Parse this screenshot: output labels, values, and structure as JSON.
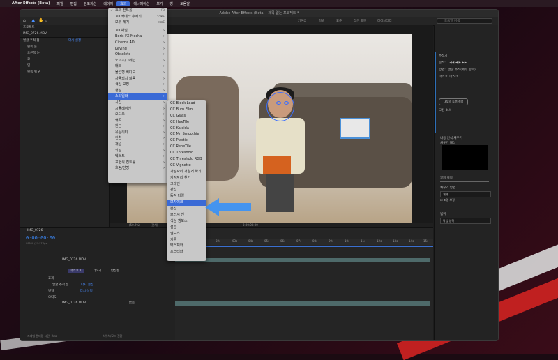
{
  "menubar": {
    "app_name": "After Effects (Beta)",
    "items": [
      "파일",
      "편집",
      "컴포지션",
      "레이어",
      "효과",
      "애니메이션",
      "보기",
      "창",
      "도움말"
    ],
    "active": "효과"
  },
  "window": {
    "title": "Adobe After Effects (Beta) - 제목 없는 프로젝트 *",
    "workspaces": [
      "기본값",
      "학습",
      "표준",
      "작은 화면",
      "라이브러리"
    ],
    "search_placeholder": "도움말 검색"
  },
  "project": {
    "tab": "프로젝트",
    "comp_tab": "IMG_0726",
    "comp_file": "IMG_0726.MOV",
    "items": [
      "얼굴 추적 점",
      "왼쪽 눈",
      "오른쪽 눈",
      "코",
      "입",
      "왼쪽 위 귀"
    ],
    "reset_label": "다시 설정"
  },
  "viewer": {
    "zoom": "(50.2%)",
    "quality": "(전체)",
    "timecode": "0:00:00:00"
  },
  "effects_menu": {
    "items": [
      {
        "label": "효과 컨트롤",
        "check": true,
        "shortcut": "F3"
      },
      {
        "label": "3D 카메라 추적기",
        "shortcut": "⌥⌘E"
      },
      {
        "label": "모두 제거",
        "shortcut": "⇧⌘E"
      },
      {
        "sep": true
      },
      {
        "label": "3D 채널",
        "sub": true
      },
      {
        "label": "Boris FX Mocha",
        "sub": true
      },
      {
        "label": "Cinema 4D",
        "sub": true
      },
      {
        "label": "Keying",
        "sub": true
      },
      {
        "label": "Obsolete",
        "sub": true
      },
      {
        "label": "노이즈/그레인",
        "sub": true
      },
      {
        "label": "매트",
        "sub": true
      },
      {
        "label": "몰입형 비디오",
        "sub": true
      },
      {
        "label": "사용되지 않음",
        "sub": true
      },
      {
        "label": "색상 교정",
        "sub": true
      },
      {
        "label": "생성",
        "sub": true
      },
      {
        "label": "스타일화",
        "sub": true,
        "highlight": true
      },
      {
        "label": "시간",
        "sub": true
      },
      {
        "label": "시뮬레이션",
        "sub": true
      },
      {
        "label": "오디오",
        "sub": true
      },
      {
        "label": "왜곡",
        "sub": true
      },
      {
        "label": "원근",
        "sub": true
      },
      {
        "label": "유틸리티",
        "sub": true
      },
      {
        "label": "전환",
        "sub": true
      },
      {
        "label": "채널",
        "sub": true
      },
      {
        "label": "키잉",
        "sub": true
      },
      {
        "label": "텍스트",
        "sub": true
      },
      {
        "label": "표현식 컨트롤",
        "sub": true
      },
      {
        "label": "흐림/선명",
        "sub": true
      }
    ]
  },
  "stylize_submenu": {
    "items": [
      "CC Block Load",
      "CC Burn Film",
      "CC Glass",
      "CC HexTile",
      "CC Kaleida",
      "CC Mr. Smoothie",
      "CC Plastic",
      "CC RepeTile",
      "CC Threshold",
      "CC Threshold RGB",
      "CC Vignette",
      "가장자리 거칠게 하기",
      "가장자리 찾기",
      "그레인",
      "광선",
      "동작 타일",
      "모자이크",
      "분산",
      "브러시 선",
      "색상 엠보스",
      "섬광",
      "엠보스",
      "카툰",
      "텍스처화",
      "포스터화"
    ],
    "highlight": "모자이크"
  },
  "tracker_panel": {
    "title": "추적기",
    "analyze_label": "분석:",
    "method_label": "방법:",
    "method_value": "얼굴 추적(세부 항목)",
    "mask_label": "마스크: 마스크 1",
    "options_button": "내부의 토끼 설정",
    "motion_label": "모션 소스"
  },
  "preview_panel": {
    "title": "내용 인식 채우기",
    "fill_target": "채우기 대상",
    "alpha_label": "알파 확장",
    "method_label": "채우기 방법",
    "method_value": "개체",
    "lighting_label": "조명 보정",
    "range_label": "범위",
    "range_value": "작업 영역"
  },
  "timeline": {
    "comp_tab": "IMG_0726",
    "timecode": "0:00:00:00",
    "fps": "00000 (29.97 fps)",
    "layer1": "IMG_0726.MOV",
    "mask": "마스크 1",
    "mask_mode": "더하기",
    "inverted": "반전됨",
    "effect_group": "효과",
    "effect_item": "얼굴 추적 점",
    "reset": "다시 설정",
    "transform": "변형",
    "audio": "오디오",
    "layer2": "IMG_0726.MOV",
    "mode": "없음",
    "ruler": [
      "0:00s",
      "01s",
      "02s",
      "03s",
      "04s",
      "05s",
      "06s",
      "07s",
      "08s",
      "09s",
      "10s",
      "11s",
      "12s",
      "13s",
      "14s",
      "15s"
    ],
    "footer": "프레임 렌더링 시간: 2ms",
    "footer_right": "스위치/모드 전환"
  }
}
